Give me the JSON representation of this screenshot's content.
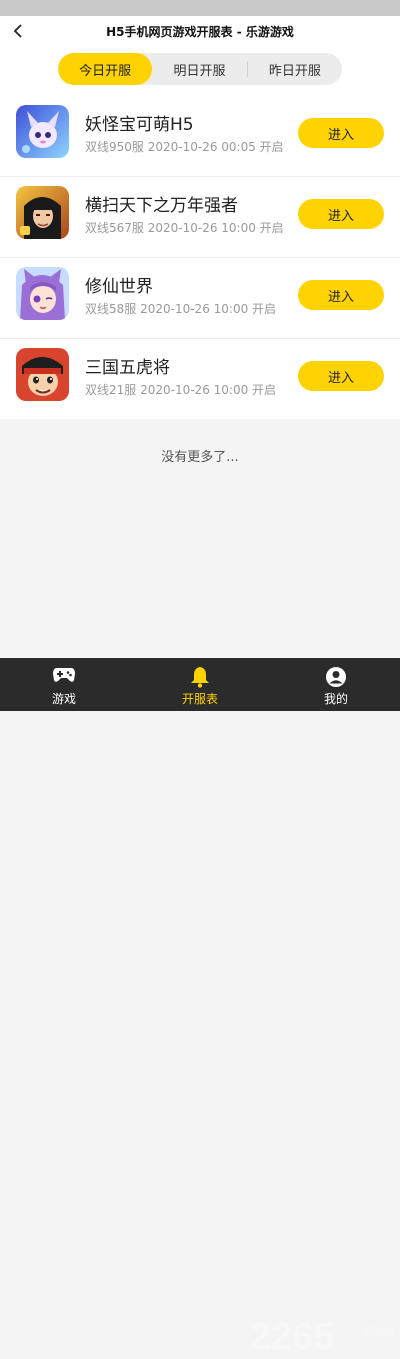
{
  "header": {
    "title": "H5手机网页游戏开服表 - 乐游游戏"
  },
  "tabs": [
    {
      "label": "今日开服",
      "active": true
    },
    {
      "label": "明日开服",
      "active": false
    },
    {
      "label": "昨日开服",
      "active": false
    }
  ],
  "games": [
    {
      "name": "妖怪宝可萌H5",
      "info": "双线950服 2020-10-26 00:05 开启",
      "button": "进入",
      "icon": "cute-creature-avatar"
    },
    {
      "name": "横扫天下之万年强者",
      "info": "双线567服 2020-10-26 10:00 开启",
      "button": "进入",
      "icon": "warrior-avatar"
    },
    {
      "name": "修仙世界",
      "info": "双线58服 2020-10-26 10:00 开启",
      "button": "进入",
      "icon": "anime-girl-avatar"
    },
    {
      "name": "三国五虎将",
      "info": "双线21服 2020-10-26 10:00 开启",
      "button": "进入",
      "icon": "three-kingdoms-hero-avatar"
    }
  ],
  "footer_text": "没有更多了...",
  "tabbar": [
    {
      "label": "游戏",
      "icon": "gamepad-icon",
      "active": false
    },
    {
      "label": "开服表",
      "icon": "bell-icon",
      "active": true
    },
    {
      "label": "我的",
      "icon": "user-icon",
      "active": false
    }
  ],
  "watermark": {
    "number": "2265",
    "site": "手游网"
  },
  "colors": {
    "accent": "#ffd300",
    "tabbar_bg": "#2b2b2b",
    "background": "#f4f4f4"
  }
}
